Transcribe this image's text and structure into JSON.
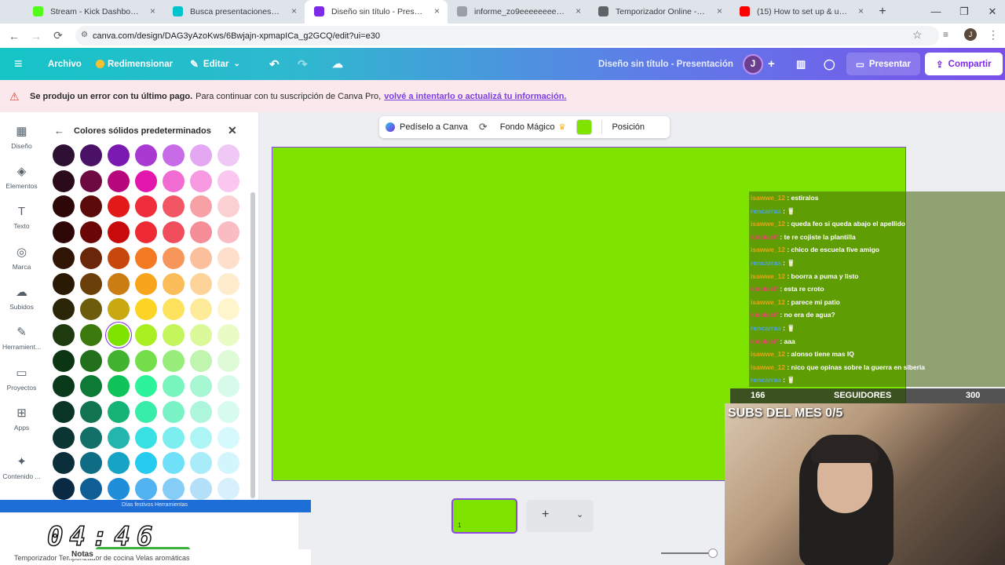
{
  "browser": {
    "tabs": [
      {
        "label": "Stream - Kick Dashboard",
        "icon": "kick-icon",
        "color": "#53fc18"
      },
      {
        "label": "Busca presentaciones - Canva",
        "icon": "canva-icon",
        "color": "#00c4cc"
      },
      {
        "label": "Diseño sin título - Presentación",
        "icon": "canva-doc-icon",
        "color": "#7d2ae8",
        "active": true
      },
      {
        "label": "informe_zo9eeeeeeeeeeeeee[1]",
        "icon": "globe-icon",
        "color": "#9aa0a6"
      },
      {
        "label": "Temporizador Online - Reloj-Al",
        "icon": "check-icon",
        "color": "#5f6368"
      },
      {
        "label": "(15) How to set up & use a De",
        "icon": "youtube-icon",
        "color": "#ff0000"
      }
    ],
    "url": "canva.com/design/DAG3yAzoKws/6Bwjajn-xpmapICa_g2GCQ/edit?ui=e30",
    "profile_initial": "J"
  },
  "toolbar": {
    "archivo": "Archivo",
    "redimensionar": "Redimensionar",
    "editar": "Editar",
    "doc_title": "Diseño sin título - Presentación",
    "user_initial": "J",
    "presentar": "Presentar",
    "compartir": "Compartir"
  },
  "error_banner": {
    "bold": "Se produjo un error con tu último pago.",
    "text": "Para continuar con tu suscripción de Canva Pro,",
    "link": "volvé a intentarlo o actualizá tu información."
  },
  "sidebar": {
    "items": [
      {
        "label": "Diseño",
        "icon": "layout-icon"
      },
      {
        "label": "Elementos",
        "icon": "shapes-icon"
      },
      {
        "label": "Texto",
        "icon": "text-icon"
      },
      {
        "label": "Marca",
        "icon": "brand-icon"
      },
      {
        "label": "Subidos",
        "icon": "upload-cloud-icon"
      },
      {
        "label": "Herramient...",
        "icon": "pen-tool-icon"
      },
      {
        "label": "Proyectos",
        "icon": "folder-icon"
      },
      {
        "label": "Apps",
        "icon": "apps-grid-icon"
      },
      {
        "label": "Contenido ...",
        "icon": "content-icon"
      }
    ]
  },
  "color_panel": {
    "title": "Colores sólidos predeterminados",
    "rows": [
      [
        "#2d1033",
        "#4a1166",
        "#7a1ab1",
        "#a83ad2",
        "#c86be6",
        "#e4a8f2",
        "#f0c8f6"
      ],
      [
        "#2b0a1c",
        "#6d0a42",
        "#b6087c",
        "#e417ad",
        "#f06cd2",
        "#f79ae2",
        "#fbc6ef"
      ],
      [
        "#2e0808",
        "#5c0b0b",
        "#e31a1a",
        "#f02d3a",
        "#f25564",
        "#f7a0a6",
        "#fbd0d2"
      ],
      [
        "#2e0707",
        "#6a0606",
        "#c90a0a",
        "#ee2a35",
        "#f04e5d",
        "#f58e96",
        "#f9bcc2"
      ],
      [
        "#301405",
        "#6b2709",
        "#c8470d",
        "#f37a22",
        "#f7965a",
        "#fbbf9b",
        "#fddfcc"
      ],
      [
        "#2a1a05",
        "#6b3f0a",
        "#c97d12",
        "#f9a41d",
        "#fbbc5a",
        "#fdd39a",
        "#feeccd"
      ],
      [
        "#2b2607",
        "#6c5c0b",
        "#c9a912",
        "#fcd425",
        "#fde25d",
        "#feeb9a",
        "#fff5cc"
      ],
      [
        "#1e3a0e",
        "#3d7a0d",
        "#7fe300",
        "#a9ef22",
        "#c4f55a",
        "#dbf89a",
        "#eafcc6"
      ],
      [
        "#0c3513",
        "#226f1c",
        "#42b330",
        "#74df4a",
        "#97ec7a",
        "#bff5ae",
        "#dffad6"
      ],
      [
        "#0a3a1a",
        "#0d7a35",
        "#10c45a",
        "#2df39a",
        "#78f4bd",
        "#a8f7d3",
        "#d6fbea"
      ],
      [
        "#0a3526",
        "#117350",
        "#16b377",
        "#38ecaa",
        "#79f2c6",
        "#aef6db",
        "#d7fbee"
      ],
      [
        "#0a3533",
        "#137068",
        "#23b5ae",
        "#39e1e4",
        "#7ceef0",
        "#aef5f6",
        "#d6fafb"
      ],
      [
        "#0a2f3b",
        "#0e6c85",
        "#16a4c4",
        "#25ccef",
        "#6ee0f7",
        "#a8ecfa",
        "#d3f5fc"
      ],
      [
        "#0a2a44",
        "#0f5f95",
        "#1e8ed8",
        "#52b3f2",
        "#85cdf7",
        "#b4e0fa",
        "#d8effc"
      ]
    ],
    "selected_row": 7,
    "selected_col": 2
  },
  "context_toolbar": {
    "ask": "Pedíselo a Canva",
    "magic": "Fondo Mágico",
    "position": "Posición",
    "swatch_color": "#7fe300"
  },
  "canvas": {
    "background": "#7fe300"
  },
  "pages": {
    "thumb_number": "1"
  },
  "overlay": {
    "chat": [
      {
        "user": "isawwe_12",
        "ucls": "u1",
        "msg": "estiralos"
      },
      {
        "user": "rencarraa",
        "ucls": "u2",
        "msg": "🥛"
      },
      {
        "user": "isawwe_12",
        "ucls": "u1",
        "msg": "queda feo si queda abajo el apellido"
      },
      {
        "user": "kinolaeff",
        "ucls": "u3",
        "msg": "te re cojiste la plantilla"
      },
      {
        "user": "isawwe_12",
        "ucls": "u1",
        "msg": "chico de escuela five amigo"
      },
      {
        "user": "rencarraa",
        "ucls": "u2",
        "msg": "🥛"
      },
      {
        "user": "isawwe_12",
        "ucls": "u1",
        "msg": "boorra a puma y listo"
      },
      {
        "user": "kinolaeff",
        "ucls": "u3",
        "msg": "esta re croto"
      },
      {
        "user": "isawwe_12",
        "ucls": "u1",
        "msg": "parece mi patio"
      },
      {
        "user": "kinolaeff",
        "ucls": "u3",
        "msg": "no era de agua?"
      },
      {
        "user": "rencarraa",
        "ucls": "u2",
        "msg": "🥛"
      },
      {
        "user": "kinolaeff",
        "ucls": "u3",
        "msg": "aaa"
      },
      {
        "user": "isawwe_12",
        "ucls": "u1",
        "msg": "alonso tiene mas IQ"
      },
      {
        "user": "isawwe_12",
        "ucls": "u1",
        "msg": "nico que opinas sobre la guerra en siberia"
      },
      {
        "user": "rencarraa",
        "ucls": "u2",
        "msg": "🥛"
      }
    ],
    "followers_current": "166",
    "followers_label": "SEGUIDORES",
    "followers_goal": "300",
    "subs_label": "SUBS DEL MES 0/5",
    "timer": "04:46",
    "timer_strip": "Días festivos    Herramientas",
    "timer_footer": "Temporizador    Temporizador de cocina    Velas aromáticas",
    "notas": "Notas"
  }
}
